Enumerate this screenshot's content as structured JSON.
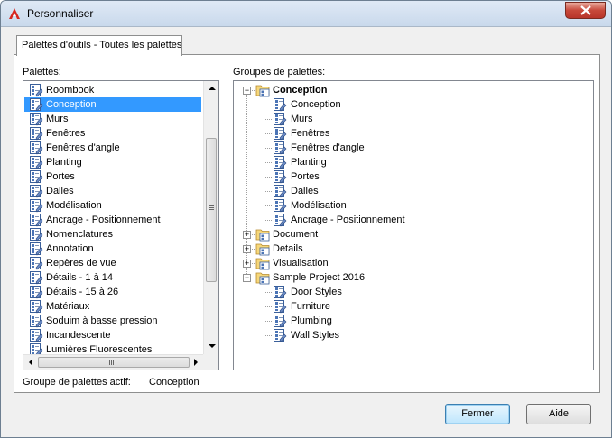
{
  "window": {
    "title": "Personnaliser"
  },
  "tabs": [
    {
      "label": "Palettes d'outils - Toutes les palettes"
    }
  ],
  "palettes": {
    "label": "Palettes:",
    "selected_index": 1,
    "items": [
      "Roombook",
      "Conception",
      "Murs",
      "Fenêtres",
      "Fenêtres d'angle",
      "Planting",
      "Portes",
      "Dalles",
      "Modélisation",
      "Ancrage - Positionnement",
      "Nomenclatures",
      "Annotation",
      "Repères de vue",
      "Détails - 1 à 14",
      "Détails - 15 à 26",
      "Matériaux",
      "Soduim à basse pression",
      "Incandescente",
      "Lumières Fluorescentes"
    ]
  },
  "groups": {
    "label": "Groupes de palettes:",
    "tree": [
      {
        "label": "Conception",
        "expanded": true,
        "bold": true,
        "children": [
          "Conception",
          "Murs",
          "Fenêtres",
          "Fenêtres d'angle",
          "Planting",
          "Portes",
          "Dalles",
          "Modélisation",
          "Ancrage - Positionnement"
        ]
      },
      {
        "label": "Document",
        "expanded": false,
        "bold": false,
        "children": []
      },
      {
        "label": "Details",
        "expanded": false,
        "bold": false,
        "children": []
      },
      {
        "label": "Visualisation",
        "expanded": false,
        "bold": false,
        "children": []
      },
      {
        "label": "Sample Project 2016",
        "expanded": true,
        "bold": false,
        "children": [
          "Door Styles",
          "Furniture",
          "Plumbing",
          "Wall Styles"
        ]
      }
    ]
  },
  "active_group": {
    "label": "Groupe de palettes actif:",
    "value": "Conception"
  },
  "buttons": {
    "close": "Fermer",
    "help": "Aide"
  },
  "icons": {
    "app": "autodesk-a-icon",
    "palette": "tool-palette-icon",
    "group": "folder-group-icon"
  },
  "colors": {
    "selection": "#3399ff",
    "app_icon": "#d7261e"
  }
}
